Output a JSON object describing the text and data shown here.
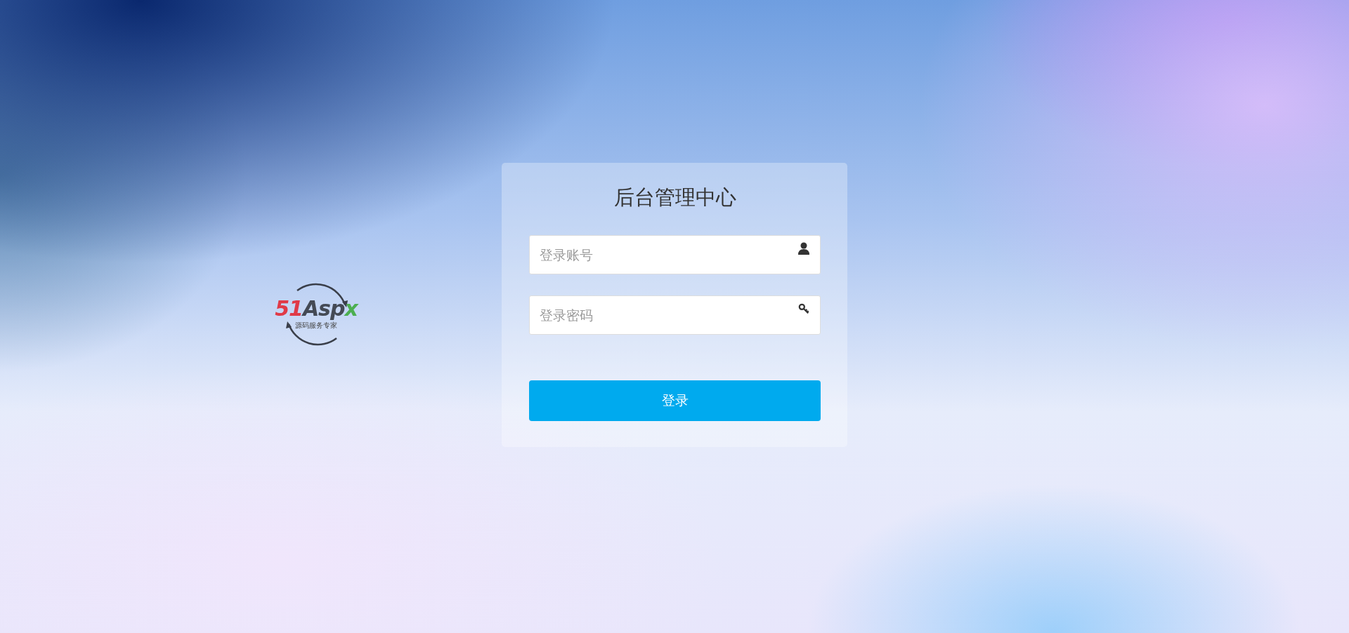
{
  "logo": {
    "brand": "51Aspx",
    "tagline": "源码服务专家"
  },
  "login": {
    "title": "后台管理中心",
    "fields": [
      {
        "kind": "user",
        "placeholder": "登录账号"
      },
      {
        "kind": "password",
        "placeholder": "登录密码"
      }
    ],
    "submit": "登录"
  }
}
